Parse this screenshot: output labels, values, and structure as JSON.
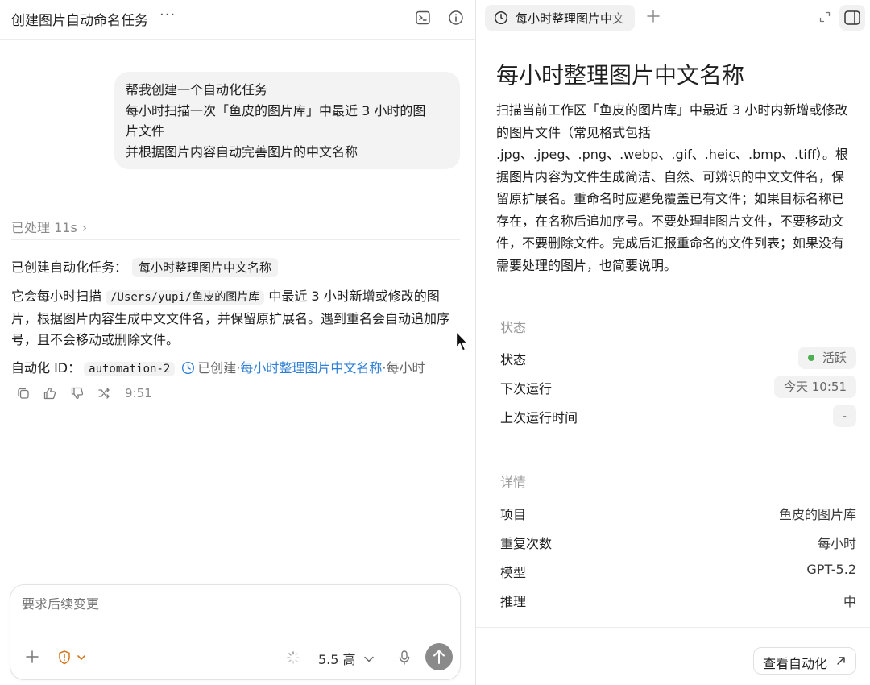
{
  "left": {
    "title": "创建图片自动命名任务",
    "more": "···",
    "user_message": [
      "帮我创建一个自动化任务",
      "每小时扫描一次「鱼皮的图片库」中最近 3 小时的图\n片文件",
      "并根据图片内容自动完善图片的中文名称"
    ],
    "processed": "已处理 11s",
    "response": {
      "line1_prefix": "已创建自动化任务：",
      "line1_chip": "每小时整理图片中文名称",
      "para_before": "它会每小时扫描 ",
      "para_code": "/Users/yupi/鱼皮的图片库",
      "para_after": " 中最近 3 小时新增或修改的图片，根据图片内容生成中文文件名，并保留原扩展名。遇到重名会自动追加序号，且不会移动或删除文件。",
      "id_label": "自动化 ID：",
      "id_value": "automation-2",
      "created": "已创建",
      "sep1": "·",
      "link": "每小时整理图片中文名称",
      "sep2": "·",
      "freq": "每小时"
    },
    "time": "9:51",
    "composer": {
      "placeholder": "要求后续变更",
      "model": "5.5 高"
    }
  },
  "right": {
    "tab_label": "每小时整理图片中文名称",
    "title": "每小时整理图片中文名称",
    "description": "扫描当前工作区「鱼皮的图片库」中最近 3 小时内新增或修改的图片文件（常见格式包括 .jpg、.jpeg、.png、.webp、.gif、.heic、.bmp、.tiff）。根据图片内容为文件生成简洁、自然、可辨识的中文文件名，保留原扩展名。重命名时应避免覆盖已有文件；如果目标名称已存在，在名称后追加序号。不要处理非图片文件，不要移动文件，不要删除文件。完成后汇报重命名的文件列表；如果没有需要处理的图片，也简要说明。",
    "status_section": "状态",
    "status_label": "状态",
    "status_value": "活跃",
    "next_run_label": "下次运行",
    "next_run_value": "今天 10:51",
    "last_run_label": "上次运行时间",
    "last_run_value": "-",
    "details_section": "详情",
    "project_label": "项目",
    "project_value": "鱼皮的图片库",
    "repeat_label": "重复次数",
    "repeat_value": "每小时",
    "model_label": "模型",
    "model_value": "GPT-5.2",
    "reasoning_label": "推理",
    "reasoning_value": "中",
    "view_button": "查看自动化"
  },
  "colors": {
    "link": "#2f7fd6",
    "active_dot": "#4cb050",
    "send_button": "#8a8a8a",
    "shield": "#d4761c"
  }
}
